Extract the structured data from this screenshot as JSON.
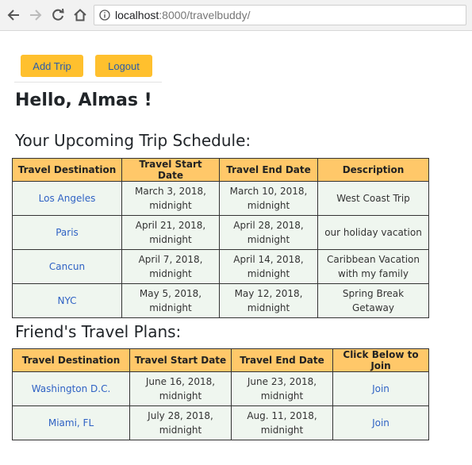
{
  "browser": {
    "url_host": "localhost",
    "url_path": ":8000/travelbuddy/"
  },
  "actions": {
    "add_trip": "Add Trip",
    "logout": "Logout"
  },
  "greeting": "Hello, Almas !",
  "schedule": {
    "title": "Your Upcoming Trip Schedule:",
    "headers": [
      "Travel Destination",
      "Travel Start Date",
      "Travel End Date",
      "Description"
    ],
    "rows": [
      {
        "destination": "Los Angeles",
        "start": "March 3, 2018, midnight",
        "end": "March 10, 2018, midnight",
        "description": "West Coast Trip"
      },
      {
        "destination": "Paris",
        "start": "April 21, 2018, midnight",
        "end": "April 28, 2018, midnight",
        "description": "our holiday vacation"
      },
      {
        "destination": "Cancun",
        "start": "April 7, 2018, midnight",
        "end": "April 14, 2018, midnight",
        "description": "Caribbean Vacation with my family"
      },
      {
        "destination": "NYC",
        "start": "May 5, 2018, midnight",
        "end": "May 12, 2018, midnight",
        "description": "Spring Break Getaway"
      }
    ]
  },
  "friends": {
    "title": "Friend's Travel Plans:",
    "headers": [
      "Travel Destination",
      "Travel Start Date",
      "Travel End Date",
      "Click Below to Join"
    ],
    "rows": [
      {
        "destination": "Washington D.C.",
        "start": "June 16, 2018, midnight",
        "end": "June 23, 2018, midnight",
        "join": "Join"
      },
      {
        "destination": "Miami, FL",
        "start": "July 28, 2018, midnight",
        "end": "Aug. 11, 2018, midnight",
        "join": "Join"
      }
    ]
  }
}
